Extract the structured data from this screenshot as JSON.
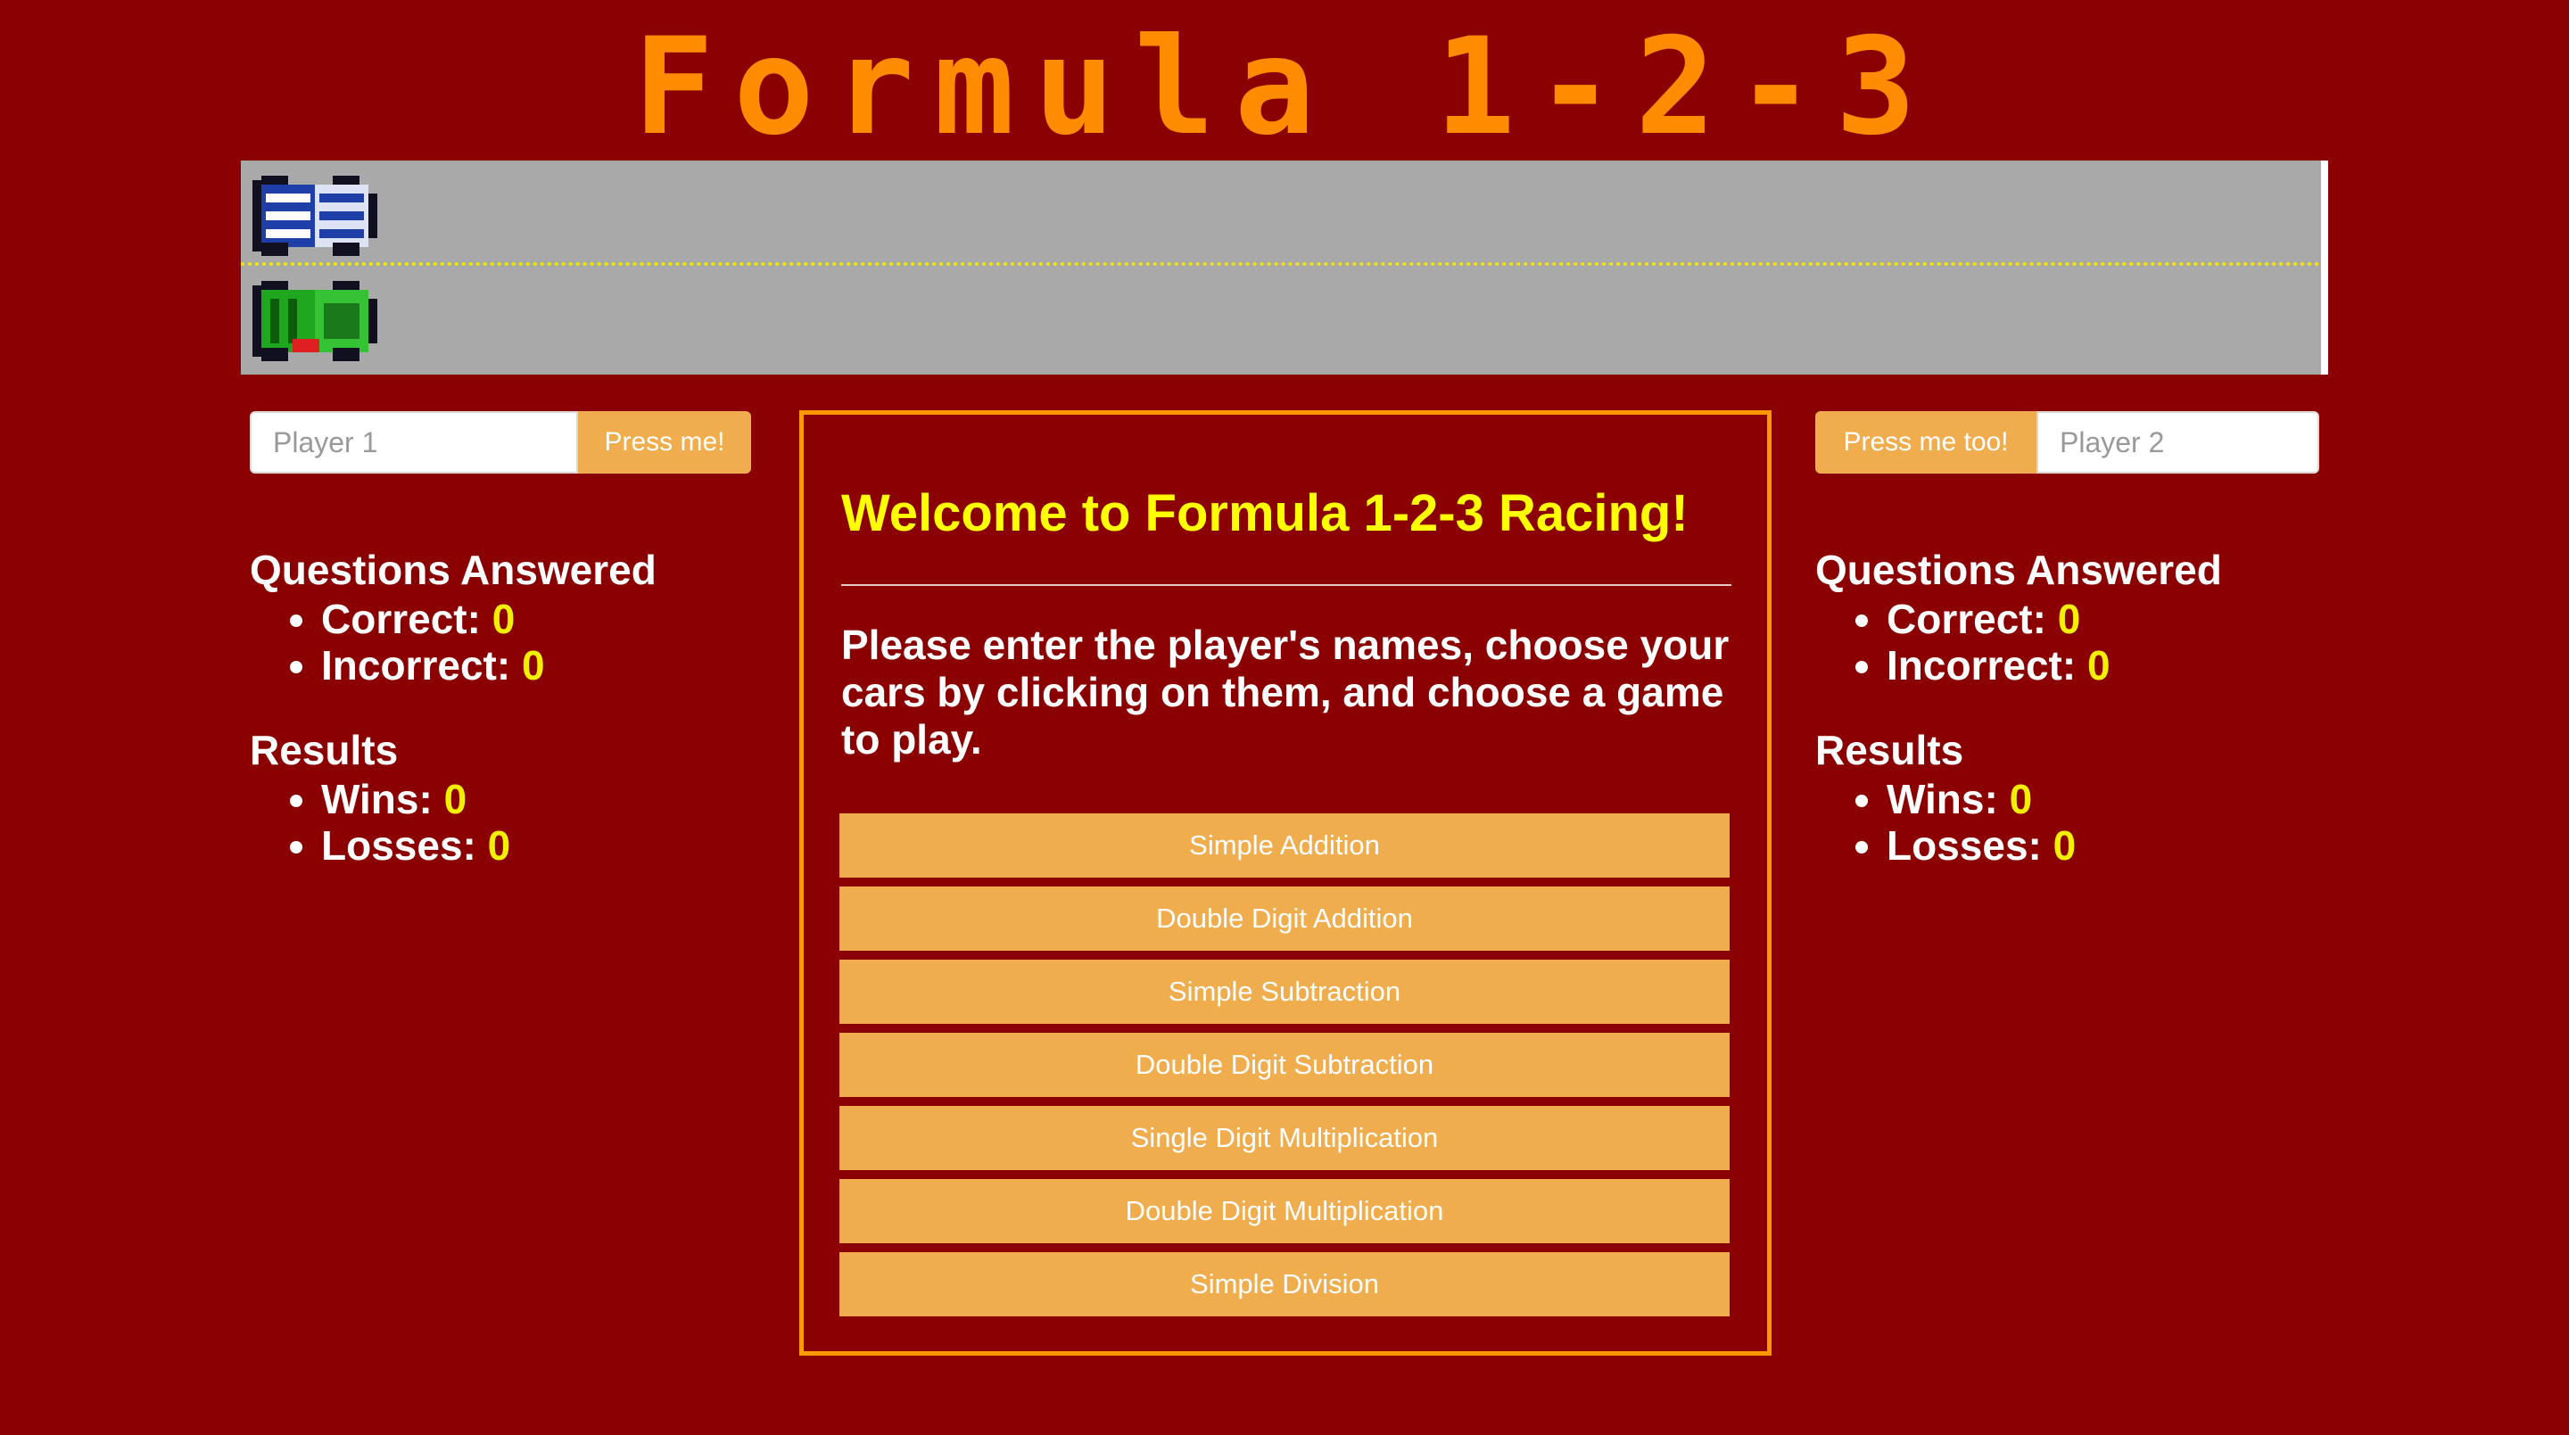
{
  "title": "Formula 1-2-3",
  "colors": {
    "background": "#8b0000",
    "title": "#ff8c00",
    "track": "#a9a9a9",
    "lane_divider": "#f2e600",
    "button": "#f0ad4e",
    "highlight": "#ffff00",
    "panel_border": "#ff9900"
  },
  "track": {
    "cars": [
      {
        "name": "blue-white-car-icon",
        "color": "#1f3fa8"
      },
      {
        "name": "green-car-icon",
        "color": "#1fa81f"
      }
    ]
  },
  "player1": {
    "placeholder": "Player 1",
    "button_label": "Press me!",
    "questions_heading": "Questions Answered",
    "correct_label": "Correct:",
    "correct_value": "0",
    "incorrect_label": "Incorrect:",
    "incorrect_value": "0",
    "results_heading": "Results",
    "wins_label": "Wins:",
    "wins_value": "0",
    "losses_label": "Losses:",
    "losses_value": "0"
  },
  "player2": {
    "placeholder": "Player 2",
    "button_label": "Press me too!",
    "questions_heading": "Questions Answered",
    "correct_label": "Correct:",
    "correct_value": "0",
    "incorrect_label": "Incorrect:",
    "incorrect_value": "0",
    "results_heading": "Results",
    "wins_label": "Wins:",
    "wins_value": "0",
    "losses_label": "Losses:",
    "losses_value": "0"
  },
  "panel": {
    "welcome": "Welcome to Formula 1-2-3 Racing!",
    "instructions": "Please enter the player's names, choose your cars by clicking on them, and choose a game to play.",
    "games": [
      "Simple Addition",
      "Double Digit Addition",
      "Simple Subtraction",
      "Double Digit Subtraction",
      "Single Digit Multiplication",
      "Double Digit Multiplication",
      "Simple Division"
    ]
  }
}
